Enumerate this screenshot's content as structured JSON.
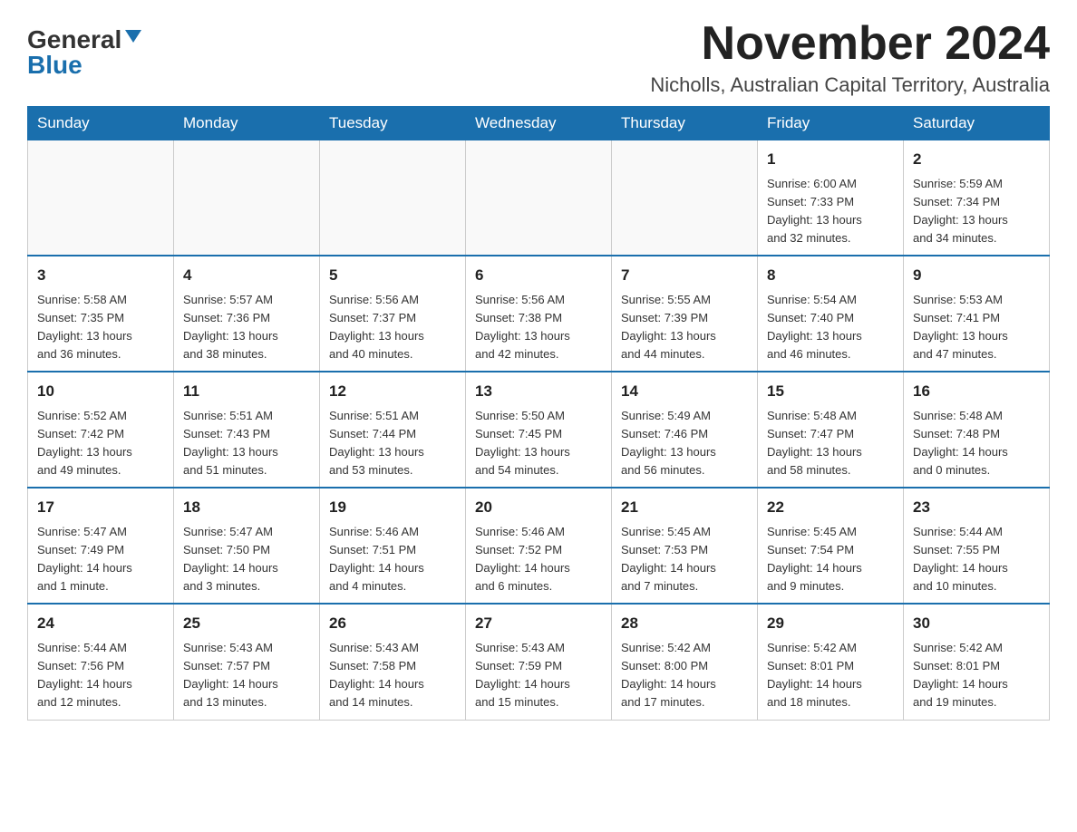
{
  "logo": {
    "general": "General",
    "blue": "Blue"
  },
  "title": "November 2024",
  "location": "Nicholls, Australian Capital Territory, Australia",
  "days_of_week": [
    "Sunday",
    "Monday",
    "Tuesday",
    "Wednesday",
    "Thursday",
    "Friday",
    "Saturday"
  ],
  "weeks": [
    [
      {
        "day": "",
        "info": ""
      },
      {
        "day": "",
        "info": ""
      },
      {
        "day": "",
        "info": ""
      },
      {
        "day": "",
        "info": ""
      },
      {
        "day": "",
        "info": ""
      },
      {
        "day": "1",
        "info": "Sunrise: 6:00 AM\nSunset: 7:33 PM\nDaylight: 13 hours\nand 32 minutes."
      },
      {
        "day": "2",
        "info": "Sunrise: 5:59 AM\nSunset: 7:34 PM\nDaylight: 13 hours\nand 34 minutes."
      }
    ],
    [
      {
        "day": "3",
        "info": "Sunrise: 5:58 AM\nSunset: 7:35 PM\nDaylight: 13 hours\nand 36 minutes."
      },
      {
        "day": "4",
        "info": "Sunrise: 5:57 AM\nSunset: 7:36 PM\nDaylight: 13 hours\nand 38 minutes."
      },
      {
        "day": "5",
        "info": "Sunrise: 5:56 AM\nSunset: 7:37 PM\nDaylight: 13 hours\nand 40 minutes."
      },
      {
        "day": "6",
        "info": "Sunrise: 5:56 AM\nSunset: 7:38 PM\nDaylight: 13 hours\nand 42 minutes."
      },
      {
        "day": "7",
        "info": "Sunrise: 5:55 AM\nSunset: 7:39 PM\nDaylight: 13 hours\nand 44 minutes."
      },
      {
        "day": "8",
        "info": "Sunrise: 5:54 AM\nSunset: 7:40 PM\nDaylight: 13 hours\nand 46 minutes."
      },
      {
        "day": "9",
        "info": "Sunrise: 5:53 AM\nSunset: 7:41 PM\nDaylight: 13 hours\nand 47 minutes."
      }
    ],
    [
      {
        "day": "10",
        "info": "Sunrise: 5:52 AM\nSunset: 7:42 PM\nDaylight: 13 hours\nand 49 minutes."
      },
      {
        "day": "11",
        "info": "Sunrise: 5:51 AM\nSunset: 7:43 PM\nDaylight: 13 hours\nand 51 minutes."
      },
      {
        "day": "12",
        "info": "Sunrise: 5:51 AM\nSunset: 7:44 PM\nDaylight: 13 hours\nand 53 minutes."
      },
      {
        "day": "13",
        "info": "Sunrise: 5:50 AM\nSunset: 7:45 PM\nDaylight: 13 hours\nand 54 minutes."
      },
      {
        "day": "14",
        "info": "Sunrise: 5:49 AM\nSunset: 7:46 PM\nDaylight: 13 hours\nand 56 minutes."
      },
      {
        "day": "15",
        "info": "Sunrise: 5:48 AM\nSunset: 7:47 PM\nDaylight: 13 hours\nand 58 minutes."
      },
      {
        "day": "16",
        "info": "Sunrise: 5:48 AM\nSunset: 7:48 PM\nDaylight: 14 hours\nand 0 minutes."
      }
    ],
    [
      {
        "day": "17",
        "info": "Sunrise: 5:47 AM\nSunset: 7:49 PM\nDaylight: 14 hours\nand 1 minute."
      },
      {
        "day": "18",
        "info": "Sunrise: 5:47 AM\nSunset: 7:50 PM\nDaylight: 14 hours\nand 3 minutes."
      },
      {
        "day": "19",
        "info": "Sunrise: 5:46 AM\nSunset: 7:51 PM\nDaylight: 14 hours\nand 4 minutes."
      },
      {
        "day": "20",
        "info": "Sunrise: 5:46 AM\nSunset: 7:52 PM\nDaylight: 14 hours\nand 6 minutes."
      },
      {
        "day": "21",
        "info": "Sunrise: 5:45 AM\nSunset: 7:53 PM\nDaylight: 14 hours\nand 7 minutes."
      },
      {
        "day": "22",
        "info": "Sunrise: 5:45 AM\nSunset: 7:54 PM\nDaylight: 14 hours\nand 9 minutes."
      },
      {
        "day": "23",
        "info": "Sunrise: 5:44 AM\nSunset: 7:55 PM\nDaylight: 14 hours\nand 10 minutes."
      }
    ],
    [
      {
        "day": "24",
        "info": "Sunrise: 5:44 AM\nSunset: 7:56 PM\nDaylight: 14 hours\nand 12 minutes."
      },
      {
        "day": "25",
        "info": "Sunrise: 5:43 AM\nSunset: 7:57 PM\nDaylight: 14 hours\nand 13 minutes."
      },
      {
        "day": "26",
        "info": "Sunrise: 5:43 AM\nSunset: 7:58 PM\nDaylight: 14 hours\nand 14 minutes."
      },
      {
        "day": "27",
        "info": "Sunrise: 5:43 AM\nSunset: 7:59 PM\nDaylight: 14 hours\nand 15 minutes."
      },
      {
        "day": "28",
        "info": "Sunrise: 5:42 AM\nSunset: 8:00 PM\nDaylight: 14 hours\nand 17 minutes."
      },
      {
        "day": "29",
        "info": "Sunrise: 5:42 AM\nSunset: 8:01 PM\nDaylight: 14 hours\nand 18 minutes."
      },
      {
        "day": "30",
        "info": "Sunrise: 5:42 AM\nSunset: 8:01 PM\nDaylight: 14 hours\nand 19 minutes."
      }
    ]
  ]
}
